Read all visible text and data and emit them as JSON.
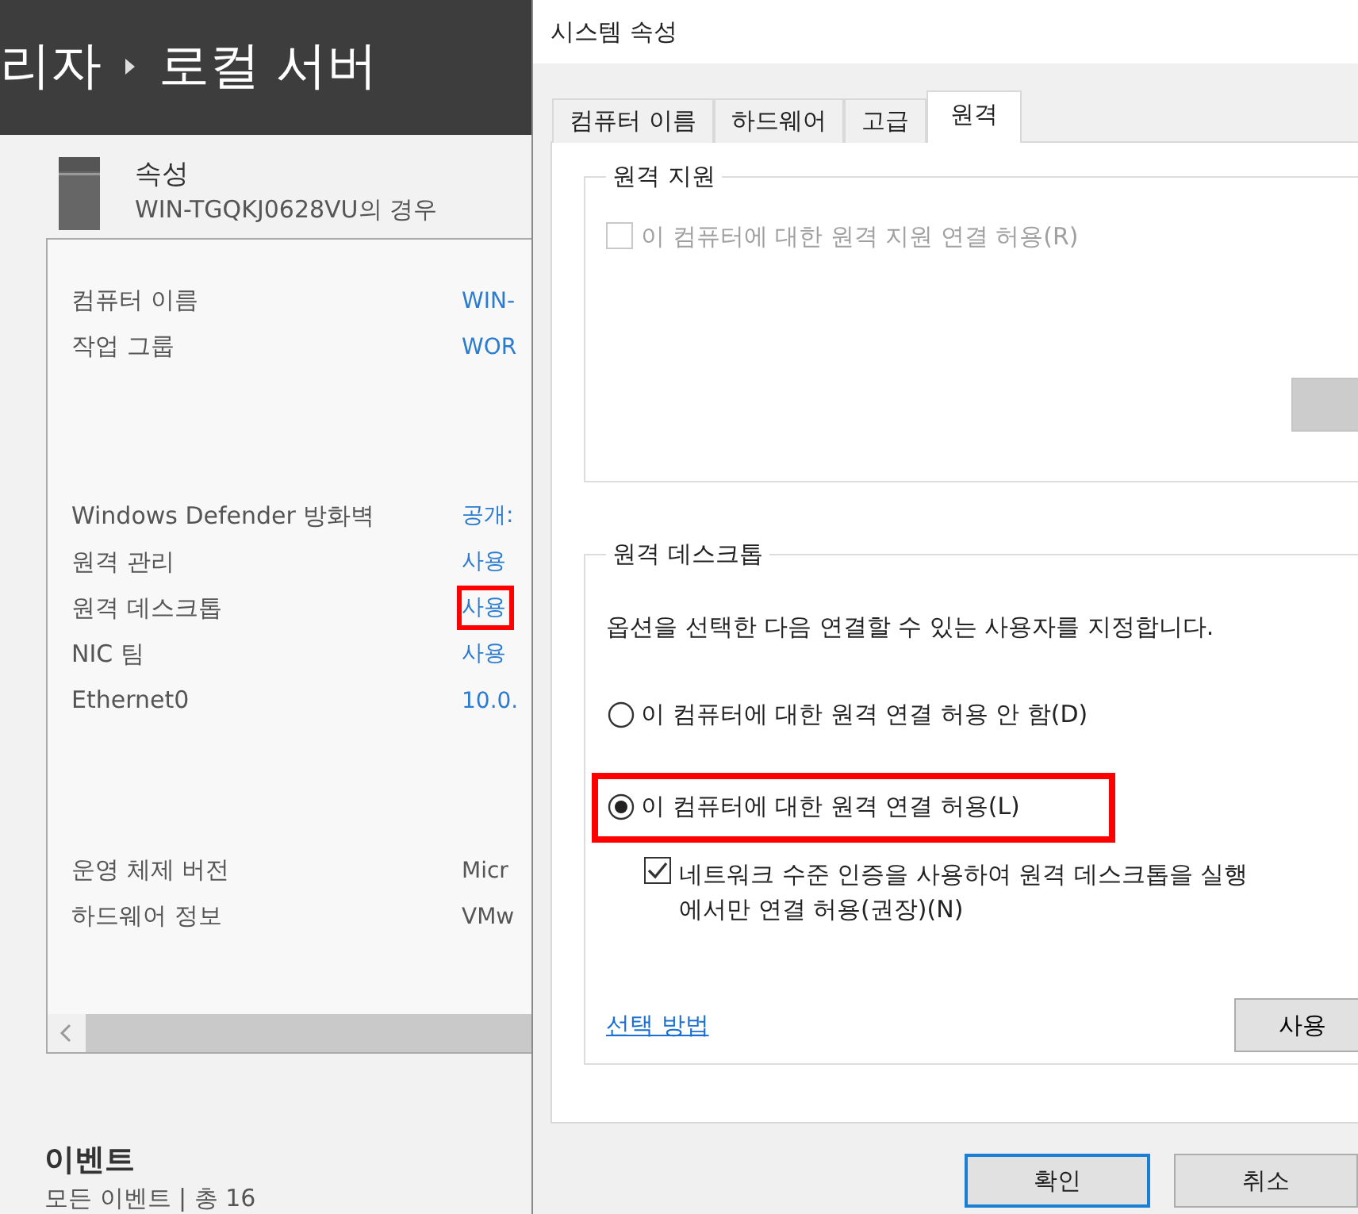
{
  "server_manager": {
    "breadcrumb": [
      "리자",
      "로컬 서버"
    ],
    "properties": {
      "title": "속성",
      "subtitle": "WIN-TGQKJ0628VU의 경우",
      "groups": [
        {
          "rows": [
            {
              "label": "컴퓨터 이름",
              "value": "WIN-",
              "kind": "link",
              "highlighted": false
            },
            {
              "label": "작업 그룹",
              "value": "WOR",
              "kind": "link",
              "highlighted": false
            }
          ]
        },
        {
          "rows": [
            {
              "label": "Windows Defender 방화벽",
              "value": "공개:",
              "kind": "link",
              "highlighted": false
            },
            {
              "label": "원격 관리",
              "value": "사용",
              "kind": "link",
              "highlighted": false
            },
            {
              "label": "원격 데스크톱",
              "value": "사용",
              "kind": "link",
              "highlighted": true
            },
            {
              "label": "NIC 팀",
              "value": "사용",
              "kind": "link",
              "highlighted": false
            },
            {
              "label": "Ethernet0",
              "value": "10.0.",
              "kind": "link",
              "highlighted": false
            }
          ]
        },
        {
          "rows": [
            {
              "label": "운영 체제 버전",
              "value": "Micr",
              "kind": "text",
              "highlighted": false
            },
            {
              "label": "하드웨어 정보",
              "value": "VMw",
              "kind": "text",
              "highlighted": false
            }
          ]
        }
      ]
    },
    "events": {
      "title": "이벤트",
      "summary": "모든 이벤트 | 총 16"
    }
  },
  "dialog": {
    "title": "시스템 속성",
    "tabs": [
      {
        "label": "컴퓨터 이름",
        "selected": false
      },
      {
        "label": "하드웨어",
        "selected": false
      },
      {
        "label": "고급",
        "selected": false
      },
      {
        "label": "원격",
        "selected": true
      }
    ],
    "remote_assistance": {
      "title": "원격 지원",
      "checkbox": {
        "label": "이 컴퓨터에 대한 원격 지원 연결 허용(R)",
        "checked": false,
        "disabled": true
      },
      "button": {
        "disabled": true
      }
    },
    "remote_desktop": {
      "title": "원격 데스크톱",
      "description": "옵션을 선택한 다음 연결할 수 있는 사용자를 지정합니다.",
      "options": [
        {
          "label": "이 컴퓨터에 대한 원격 연결 허용 안 함(D)",
          "selected": false,
          "highlighted": false
        },
        {
          "label": "이 컴퓨터에 대한 원격 연결 허용(L)",
          "selected": true,
          "highlighted": true
        }
      ],
      "nla": {
        "lines": [
          "네트워크 수준 인증을 사용하여 원격 데스크톱을 실행",
          "에서만 연결 허용(권장)(N)"
        ],
        "checked": true
      },
      "link": "선택 방법",
      "users_button": "사용"
    },
    "buttons": [
      {
        "label": "확인",
        "default": true
      },
      {
        "label": "취소",
        "default": false
      }
    ]
  }
}
